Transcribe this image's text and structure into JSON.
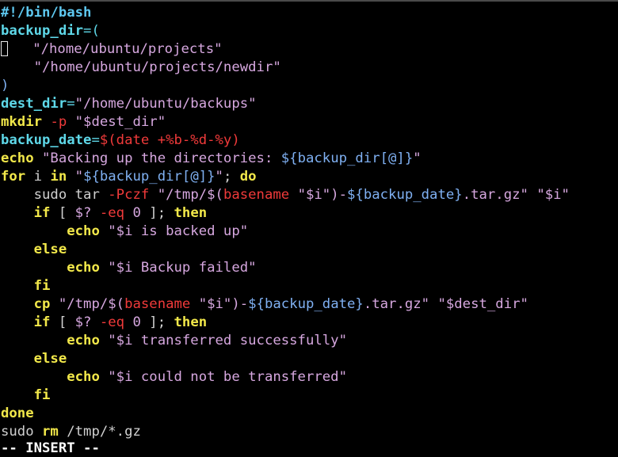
{
  "colors": {
    "background": "#000000",
    "default": "#d0d0d0",
    "comment": "#5ec8f0",
    "variable": "#5ed7e8",
    "statement": "#f2e84a",
    "string": "#d6a7df",
    "special": "#f03a3a",
    "substitution": "#7fb0f2",
    "mode": "#ffffff"
  },
  "editor": {
    "lines": [
      {
        "tokens": [
          {
            "t": "#!/bin/bash",
            "c": "comment",
            "b": true
          }
        ]
      },
      {
        "tokens": [
          {
            "t": "backup_dir",
            "c": "variable",
            "b": true
          },
          {
            "t": "=(",
            "c": "variable"
          }
        ]
      },
      {
        "cursor": true,
        "tokens": [
          {
            "t": "   ",
            "c": "default"
          },
          {
            "t": "\"/home/ubuntu/projects\"",
            "c": "string"
          }
        ]
      },
      {
        "tokens": [
          {
            "t": "    ",
            "c": "default"
          },
          {
            "t": "\"/home/ubuntu/projects/newdir\"",
            "c": "string"
          }
        ]
      },
      {
        "tokens": [
          {
            "t": ")",
            "c": "substitution"
          }
        ]
      },
      {
        "tokens": [
          {
            "t": "dest_dir",
            "c": "variable",
            "b": true
          },
          {
            "t": "=",
            "c": "variable"
          },
          {
            "t": "\"/home/ubuntu/backups\"",
            "c": "string"
          }
        ]
      },
      {
        "tokens": [
          {
            "t": "mkdir",
            "c": "statement",
            "b": true
          },
          {
            "t": " ",
            "c": "default"
          },
          {
            "t": "-p",
            "c": "special"
          },
          {
            "t": " ",
            "c": "default"
          },
          {
            "t": "\"$dest_dir\"",
            "c": "string"
          }
        ]
      },
      {
        "tokens": [
          {
            "t": "backup_date",
            "c": "variable",
            "b": true
          },
          {
            "t": "=",
            "c": "variable"
          },
          {
            "t": "$(",
            "c": "special"
          },
          {
            "t": "date +%b-%d-%y",
            "c": "special"
          },
          {
            "t": ")",
            "c": "special"
          }
        ]
      },
      {
        "tokens": [
          {
            "t": "echo",
            "c": "statement",
            "b": true
          },
          {
            "t": " ",
            "c": "default"
          },
          {
            "t": "\"Backing up the directories: ",
            "c": "string"
          },
          {
            "t": "${backup_dir[@]}",
            "c": "substitution"
          },
          {
            "t": "\"",
            "c": "string"
          }
        ]
      },
      {
        "tokens": [
          {
            "t": "for",
            "c": "statement",
            "b": true
          },
          {
            "t": " i ",
            "c": "default"
          },
          {
            "t": "in",
            "c": "statement",
            "b": true
          },
          {
            "t": " ",
            "c": "default"
          },
          {
            "t": "\"",
            "c": "string"
          },
          {
            "t": "${backup_dir[@]}",
            "c": "substitution"
          },
          {
            "t": "\"",
            "c": "string"
          },
          {
            "t": "; ",
            "c": "default"
          },
          {
            "t": "do",
            "c": "statement",
            "b": true
          }
        ]
      },
      {
        "tokens": [
          {
            "t": "    sudo tar ",
            "c": "default"
          },
          {
            "t": "-Pczf",
            "c": "special"
          },
          {
            "t": " ",
            "c": "default"
          },
          {
            "t": "\"/tmp/$(",
            "c": "string"
          },
          {
            "t": "basename",
            "c": "special"
          },
          {
            "t": " ",
            "c": "string"
          },
          {
            "t": "\"$i\"",
            "c": "string"
          },
          {
            "t": ")-",
            "c": "string"
          },
          {
            "t": "${backup_date}",
            "c": "substitution"
          },
          {
            "t": ".tar.gz\"",
            "c": "string"
          },
          {
            "t": " ",
            "c": "default"
          },
          {
            "t": "\"$i\"",
            "c": "string"
          }
        ]
      },
      {
        "tokens": [
          {
            "t": "    ",
            "c": "default"
          },
          {
            "t": "if",
            "c": "statement",
            "b": true
          },
          {
            "t": " [ ",
            "c": "default"
          },
          {
            "t": "$?",
            "c": "string"
          },
          {
            "t": " ",
            "c": "default"
          },
          {
            "t": "-eq",
            "c": "special"
          },
          {
            "t": " ",
            "c": "default"
          },
          {
            "t": "0",
            "c": "string"
          },
          {
            "t": " ]; ",
            "c": "default"
          },
          {
            "t": "then",
            "c": "statement",
            "b": true
          }
        ]
      },
      {
        "tokens": [
          {
            "t": "        ",
            "c": "default"
          },
          {
            "t": "echo",
            "c": "statement",
            "b": true
          },
          {
            "t": " ",
            "c": "default"
          },
          {
            "t": "\"$i is backed up\"",
            "c": "string"
          }
        ]
      },
      {
        "tokens": [
          {
            "t": "    ",
            "c": "default"
          },
          {
            "t": "else",
            "c": "statement",
            "b": true
          }
        ]
      },
      {
        "tokens": [
          {
            "t": "        ",
            "c": "default"
          },
          {
            "t": "echo",
            "c": "statement",
            "b": true
          },
          {
            "t": " ",
            "c": "default"
          },
          {
            "t": "\"$i Backup failed\"",
            "c": "string"
          }
        ]
      },
      {
        "tokens": [
          {
            "t": "    ",
            "c": "default"
          },
          {
            "t": "fi",
            "c": "statement",
            "b": true
          }
        ]
      },
      {
        "tokens": [
          {
            "t": "    ",
            "c": "default"
          },
          {
            "t": "cp",
            "c": "statement",
            "b": true
          },
          {
            "t": " ",
            "c": "default"
          },
          {
            "t": "\"/tmp/$(",
            "c": "string"
          },
          {
            "t": "basename",
            "c": "special"
          },
          {
            "t": " ",
            "c": "string"
          },
          {
            "t": "\"$i\"",
            "c": "string"
          },
          {
            "t": ")-",
            "c": "string"
          },
          {
            "t": "${backup_date}",
            "c": "substitution"
          },
          {
            "t": ".tar.gz\"",
            "c": "string"
          },
          {
            "t": " ",
            "c": "default"
          },
          {
            "t": "\"$dest_dir\"",
            "c": "string"
          }
        ]
      },
      {
        "tokens": [
          {
            "t": "    ",
            "c": "default"
          },
          {
            "t": "if",
            "c": "statement",
            "b": true
          },
          {
            "t": " [ ",
            "c": "default"
          },
          {
            "t": "$?",
            "c": "string"
          },
          {
            "t": " ",
            "c": "default"
          },
          {
            "t": "-eq",
            "c": "special"
          },
          {
            "t": " ",
            "c": "default"
          },
          {
            "t": "0",
            "c": "string"
          },
          {
            "t": " ]; ",
            "c": "default"
          },
          {
            "t": "then",
            "c": "statement",
            "b": true
          }
        ]
      },
      {
        "tokens": [
          {
            "t": "        ",
            "c": "default"
          },
          {
            "t": "echo",
            "c": "statement",
            "b": true
          },
          {
            "t": " ",
            "c": "default"
          },
          {
            "t": "\"$i transferred successfully\"",
            "c": "string"
          }
        ]
      },
      {
        "tokens": [
          {
            "t": "    ",
            "c": "default"
          },
          {
            "t": "else",
            "c": "statement",
            "b": true
          }
        ]
      },
      {
        "tokens": [
          {
            "t": "        ",
            "c": "default"
          },
          {
            "t": "echo",
            "c": "statement",
            "b": true
          },
          {
            "t": " ",
            "c": "default"
          },
          {
            "t": "\"$i could not be transferred\"",
            "c": "string"
          }
        ]
      },
      {
        "tokens": [
          {
            "t": "    ",
            "c": "default"
          },
          {
            "t": "fi",
            "c": "statement",
            "b": true
          }
        ]
      },
      {
        "tokens": [
          {
            "t": "done",
            "c": "statement",
            "b": true
          }
        ]
      },
      {
        "tokens": [
          {
            "t": "sudo ",
            "c": "default"
          },
          {
            "t": "rm",
            "c": "statement",
            "b": true
          },
          {
            "t": " /tmp/*.gz",
            "c": "default"
          }
        ]
      }
    ]
  },
  "status": {
    "mode": "-- INSERT --"
  }
}
